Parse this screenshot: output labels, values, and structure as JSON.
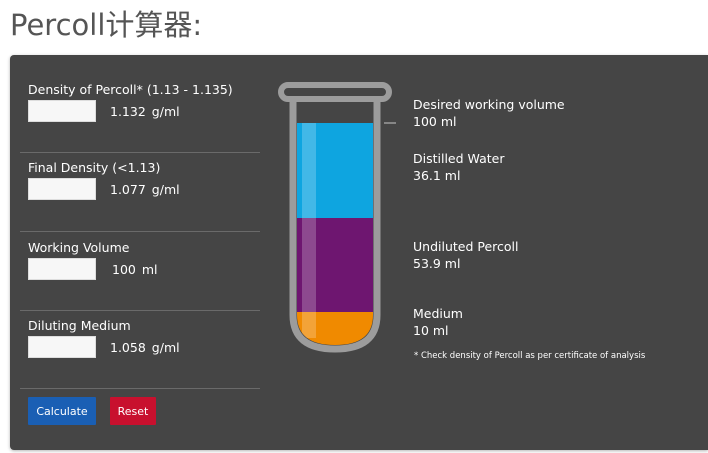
{
  "page": {
    "title": "Percoll计算器:"
  },
  "form": {
    "fields": [
      {
        "label": "Density of Percoll* (1.13 - 1.135)",
        "input_value": "",
        "value": "1.132",
        "unit": "g/ml"
      },
      {
        "label": "Final Density (<1.13)",
        "input_value": "",
        "value": "1.077",
        "unit": "g/ml"
      },
      {
        "label": "Working Volume",
        "input_value": "",
        "value": "100",
        "unit": "ml"
      },
      {
        "label": "Diluting Medium",
        "input_value": "",
        "value": "1.058",
        "unit": "g/ml"
      }
    ],
    "buttons": {
      "calculate": "Calculate",
      "reset": "Reset"
    }
  },
  "tube": {
    "total_volume_ml": 100,
    "layers": [
      {
        "name": "Distilled Water",
        "color": "#0ea5e0"
      },
      {
        "name": "Undiluted Percoll",
        "color": "#6e1670"
      },
      {
        "name": "Medium",
        "color": "#f08a00"
      }
    ]
  },
  "results": {
    "working_volume": {
      "label": "Desired working volume",
      "value": "100 ml"
    },
    "water": {
      "label": "Distilled Water",
      "value": "36.1 ml"
    },
    "percoll": {
      "label": "Undiluted Percoll",
      "value": "53.9 ml"
    },
    "medium": {
      "label": "Medium",
      "value": "10 ml"
    },
    "note": "* Check density of Percoll as per certificate of analysis"
  },
  "colors": {
    "panel_bg": "#454545",
    "calculate_button": "#1a5fb4",
    "reset_button": "#c8102e",
    "tube_outline": "#9c9c9c"
  }
}
